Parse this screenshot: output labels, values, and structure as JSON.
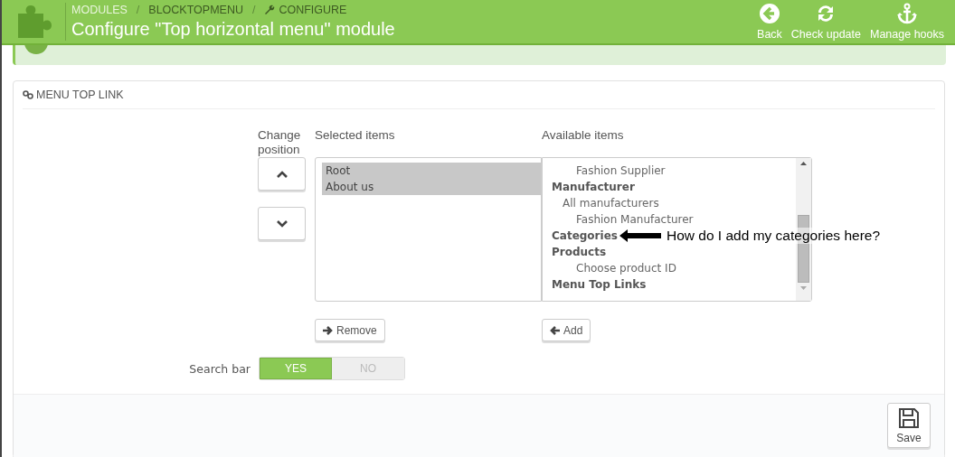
{
  "header": {
    "breadcrumb": [
      {
        "kind": "link",
        "text": "MODULES"
      },
      {
        "kind": "separator",
        "text": "/"
      },
      {
        "kind": "link",
        "text": "BLOCKTOPMENU"
      },
      {
        "kind": "separator",
        "text": "/"
      },
      {
        "kind": "current",
        "text": "CONFIGURE"
      }
    ],
    "title": "Configure \"Top horizontal menu\" module",
    "toolbar": [
      {
        "kind": "back",
        "label": "Back"
      },
      {
        "kind": "refresh",
        "label": "Check update"
      },
      {
        "kind": "anchor",
        "label": "Manage hooks"
      }
    ]
  },
  "panel": {
    "heading": "MENU TOP LINK",
    "position_label": "Change position",
    "selected_items": {
      "label": "Selected items",
      "options": [
        {
          "label": "Root",
          "selected": true
        },
        {
          "label": "About us",
          "selected": true
        }
      ]
    },
    "available_items": {
      "label": "Available items",
      "options": [
        {
          "children": [
            {
              "children": [
                {
                  "label": "Fashion Supplier",
                  "selected": false
                }
              ]
            }
          ]
        },
        {
          "label": "Manufacturer",
          "selected": false,
          "children": [
            {
              "label": "All manufacturers",
              "selected": false,
              "children": [
                {
                  "label": "Fashion Manufacturer",
                  "selected": false
                }
              ]
            }
          ]
        },
        {
          "label": "Categories",
          "selected": false
        },
        {
          "label": "Products",
          "selected": false,
          "children": [
            {
              "children": [
                {
                  "label": "Choose product ID",
                  "selected": false
                }
              ]
            }
          ]
        },
        {
          "label": "Menu Top Links",
          "selected": false
        }
      ]
    },
    "remove_button": "Remove",
    "add_button": "Add",
    "search_bar": {
      "label": "Search bar",
      "options": [
        {
          "label": "YES",
          "selected": true
        },
        {
          "label": "NO",
          "selected": false
        }
      ]
    },
    "save_button": "Save"
  },
  "annotation": {
    "text": "How do I add my categories here?"
  }
}
